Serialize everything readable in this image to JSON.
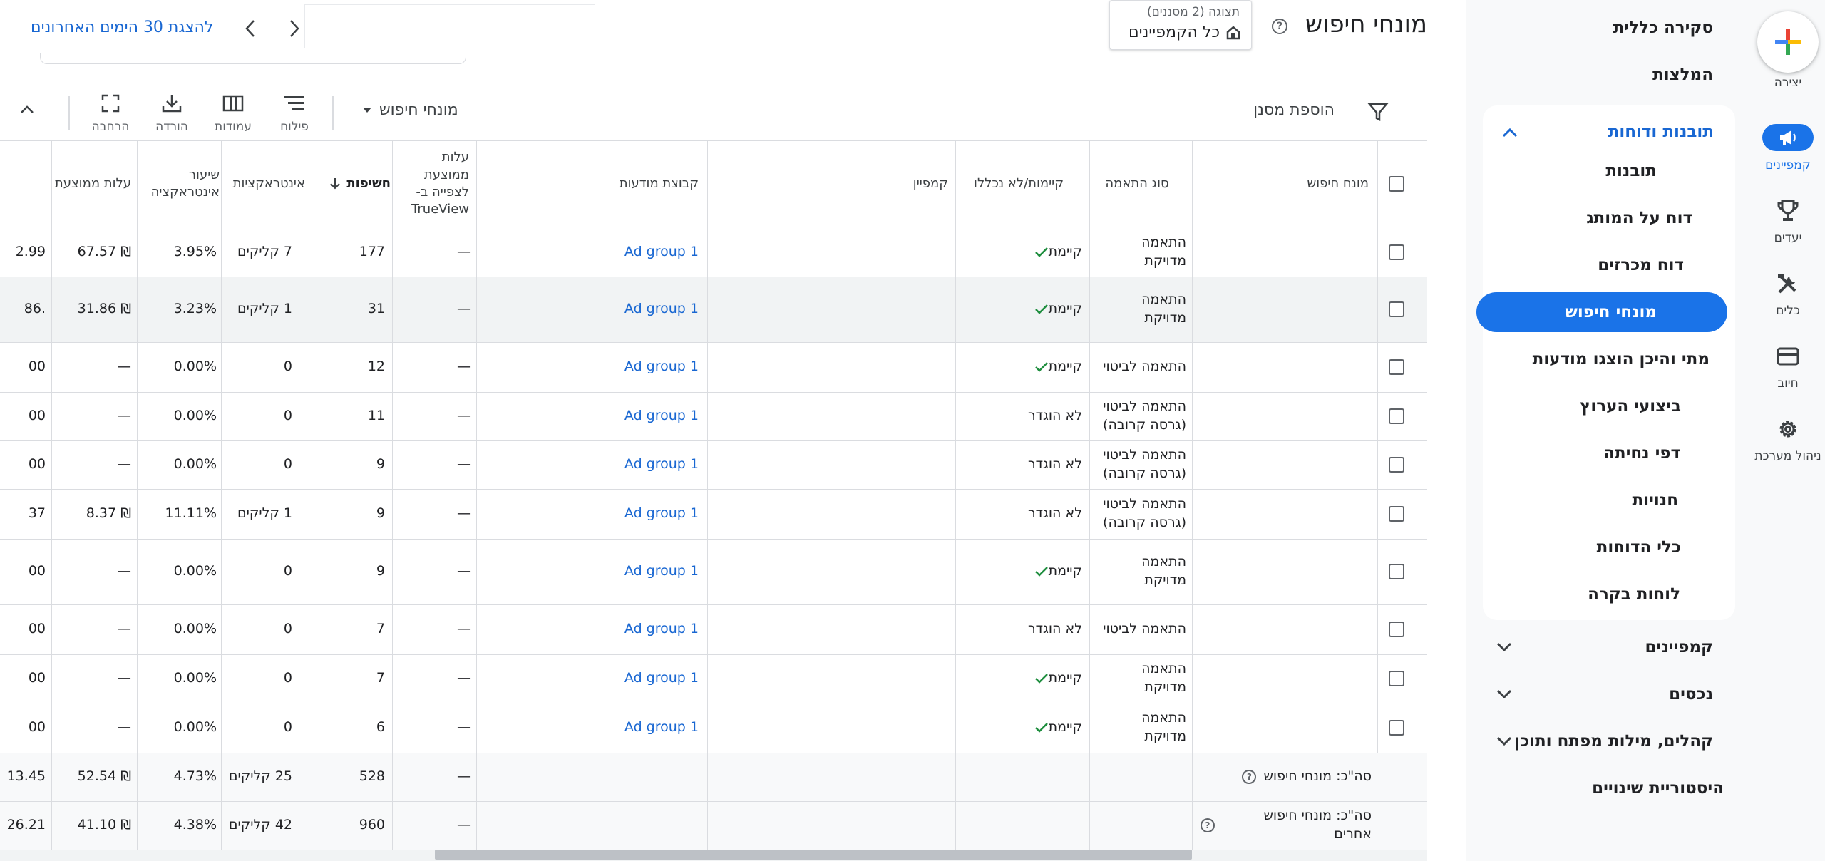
{
  "rail": {
    "create_label": "יצירה",
    "items": [
      {
        "label": "קמפיינים",
        "icon": "megaphone-icon",
        "active": true
      },
      {
        "label": "יעדים",
        "icon": "trophy-icon",
        "active": false
      },
      {
        "label": "כלים",
        "icon": "tools-icon",
        "active": false
      },
      {
        "label": "חיוב",
        "icon": "credit-card-icon",
        "active": false
      },
      {
        "label": "ניהול מערכת",
        "icon": "gear-icon",
        "active": false
      }
    ]
  },
  "nav": {
    "overview": "סקירה כללית",
    "recommendations": "המלצות",
    "reports_group": "תובנות ודוחות",
    "reports_items": [
      "תובנות",
      "דוח על המותג",
      "דוח מכרזים",
      "מונחי חיפוש",
      "מתי והיכן הוצגו מודעות",
      "ביצועי הערוץ",
      "דפי נחיתה",
      "חנויות",
      "כלי הדוחות",
      "לוחות בקרה"
    ],
    "active_index": 3,
    "campaigns_group": "קמפיינים",
    "assets_group": "נכסים",
    "audiences_group": "קהלים, מילות מפתח ותוכן",
    "change_history": "היסטוריית שינויים"
  },
  "header": {
    "title": "מונחי חיפוש",
    "view_small": "תצוגה (2 מסננים)",
    "view_main": "כל הקמפיינים",
    "date_link": "להצגת 30 הימים האחרונים"
  },
  "toolbar": {
    "add_filter": "הוספת מסנן",
    "segment": "מונחי חיפוש",
    "filter_label": "פילוח",
    "columns_label": "עמודות",
    "download_label": "הורדה",
    "expand_label": "הרחבה"
  },
  "table": {
    "headers": {
      "search_term": "מונח חיפוש",
      "match_type": "סוג התאמה",
      "added": "קיימות/לא נכללו",
      "campaign": "קמפיין",
      "ad_group": "קבוצת מודעות",
      "trueview_cpv": "עלות ממוצעת לצפייה ב- TrueView",
      "impressions": "חשיפות",
      "interactions": "אינטראקציות",
      "interaction_rate": "שיעור אינטראקציה",
      "avg_cost": "עלות ממוצעת"
    },
    "rows": [
      {
        "match": "התאמה מדויקת",
        "added": "קיימת",
        "added_check": true,
        "ad_group": "Ad group 1",
        "cpv": "—",
        "impr": "177",
        "inter": "7 קליקים",
        "rate": "3.95%",
        "avg": "₪ 67.57",
        "cut": "2.99"
      },
      {
        "match": "התאמה מדויקת",
        "added": "קיימת",
        "added_check": true,
        "ad_group": "Ad group 1",
        "cpv": "—",
        "impr": "31",
        "inter": "1 קליקים",
        "rate": "3.23%",
        "avg": "₪ 31.86",
        "cut": ".86"
      },
      {
        "match": "התאמה לביטוי",
        "added": "קיימת",
        "added_check": true,
        "ad_group": "Ad group 1",
        "cpv": "—",
        "impr": "12",
        "inter": "0",
        "rate": "0.00%",
        "avg": "—",
        "cut": "00"
      },
      {
        "match": "התאמה לביטוי (גרסה קרובה)",
        "added": "לא הוגדר",
        "added_check": false,
        "ad_group": "Ad group 1",
        "cpv": "—",
        "impr": "11",
        "inter": "0",
        "rate": "0.00%",
        "avg": "—",
        "cut": "00"
      },
      {
        "match": "התאמה לביטוי (גרסה קרובה)",
        "added": "לא הוגדר",
        "added_check": false,
        "ad_group": "Ad group 1",
        "cpv": "—",
        "impr": "9",
        "inter": "0",
        "rate": "0.00%",
        "avg": "—",
        "cut": "00"
      },
      {
        "match": "התאמה לביטוי (גרסה קרובה)",
        "added": "לא הוגדר",
        "added_check": false,
        "ad_group": "Ad group 1",
        "cpv": "—",
        "impr": "9",
        "inter": "1 קליקים",
        "rate": "11.11%",
        "avg": "₪ 8.37",
        "cut": "37"
      },
      {
        "match": "התאמה מדויקת",
        "added": "קיימת",
        "added_check": true,
        "ad_group": "Ad group 1",
        "cpv": "—",
        "impr": "9",
        "inter": "0",
        "rate": "0.00%",
        "avg": "—",
        "cut": "00"
      },
      {
        "match": "התאמה לביטוי",
        "added": "לא הוגדר",
        "added_check": false,
        "ad_group": "Ad group 1",
        "cpv": "—",
        "impr": "7",
        "inter": "0",
        "rate": "0.00%",
        "avg": "—",
        "cut": "00"
      },
      {
        "match": "התאמה מדויקת",
        "added": "קיימת",
        "added_check": true,
        "ad_group": "Ad group 1",
        "cpv": "—",
        "impr": "7",
        "inter": "0",
        "rate": "0.00%",
        "avg": "—",
        "cut": "00"
      },
      {
        "match": "התאמה מדויקת",
        "added": "קיימת",
        "added_check": true,
        "ad_group": "Ad group 1",
        "cpv": "—",
        "impr": "6",
        "inter": "0",
        "rate": "0.00%",
        "avg": "—",
        "cut": "00"
      }
    ],
    "totals": [
      {
        "label": "סה\"כ: מונחי חיפוש",
        "cpv": "—",
        "impr": "528",
        "inter": "25 קליקים",
        "rate": "4.73%",
        "avg": "₪ 52.54",
        "cut": "13.45"
      },
      {
        "label": "סה\"כ: מונחי חיפוש אחרים",
        "cpv": "—",
        "impr": "960",
        "inter": "42 קליקים",
        "rate": "4.38%",
        "avg": "₪ 41.10",
        "cut": "26.21"
      }
    ]
  }
}
